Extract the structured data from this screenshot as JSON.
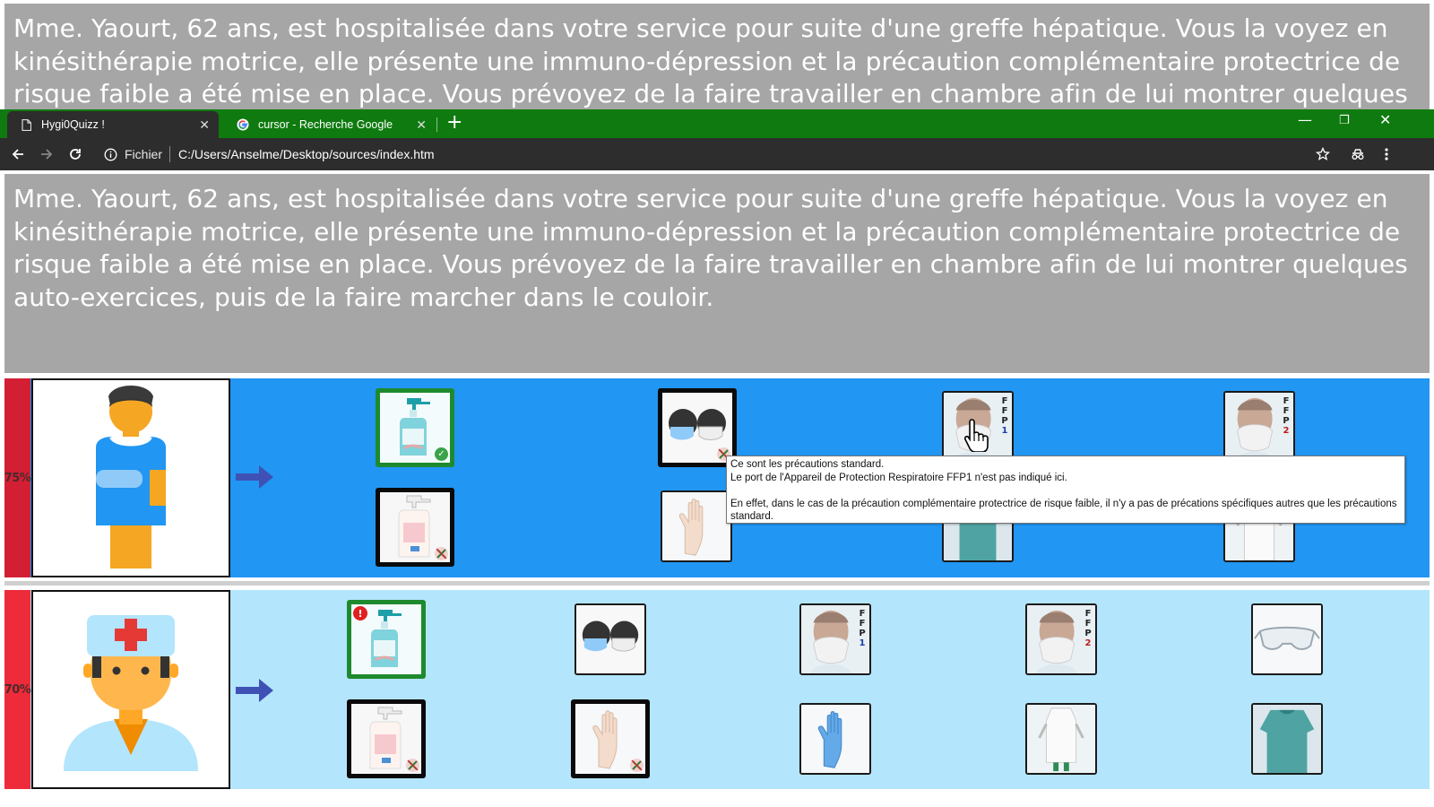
{
  "scenario": {
    "text": "Mme. Yaourt, 62 ans, est hospitalisée dans votre service pour suite d'une greffe hépatique. Vous la voyez en kinésithérapie motrice, elle présente une immuno-dépression et la précaution complémentaire protectrice de risque faible a été mise en place. Vous prévoyez de la faire travailler en chambre afin de lui montrer quelques auto-exercices, puis de la faire marcher dans le couloir."
  },
  "browser": {
    "tabs": [
      {
        "title": "Hygi0Quizz !",
        "icon": "page-icon",
        "active": true
      },
      {
        "title": "cursor - Recherche Google",
        "icon": "google-icon",
        "active": false
      }
    ],
    "new_tab": "+",
    "security_chip": "Fichier",
    "url": "C:/Users/Anselme/Desktop/sources/index.htm",
    "window_controls": {
      "minimize": "—",
      "restore": "❐",
      "close": "✕"
    }
  },
  "rows": [
    {
      "score": "75%",
      "role": "patient",
      "avatar_icon": "patient-icon",
      "items": [
        {
          "name": "hydroalcoholic-gel",
          "state": "selected-correct",
          "badge": "✓"
        },
        {
          "name": "surgical-masks",
          "state": "selected-wrong"
        },
        {
          "name": "ffp1-respirator",
          "state": "unselected",
          "ffp": [
            "F",
            "F",
            "P",
            "1"
          ]
        },
        {
          "name": "ffp2-respirator",
          "state": "unselected",
          "ffp": [
            "F",
            "F",
            "P",
            "2"
          ]
        },
        {
          "name": "soap-dispenser",
          "state": "selected-wrong"
        },
        {
          "name": "latex-gloves",
          "state": "unselected"
        },
        {
          "name": "surgical-gown",
          "state": "unselected"
        },
        {
          "name": "plastic-apron",
          "state": "unselected"
        }
      ]
    },
    {
      "score": "70%",
      "role": "nurse",
      "avatar_icon": "nurse-icon",
      "items": [
        {
          "name": "hydroalcoholic-gel",
          "state": "selected-warning",
          "badge": "!"
        },
        {
          "name": "surgical-masks",
          "state": "unselected"
        },
        {
          "name": "ffp1-respirator",
          "state": "unselected",
          "ffp": [
            "F",
            "F",
            "P",
            "1"
          ]
        },
        {
          "name": "ffp2-respirator",
          "state": "unselected",
          "ffp": [
            "F",
            "F",
            "P",
            "2"
          ]
        },
        {
          "name": "safety-goggles",
          "state": "unselected"
        },
        {
          "name": "soap-dispenser",
          "state": "selected-wrong"
        },
        {
          "name": "latex-gloves",
          "state": "selected-wrong"
        },
        {
          "name": "nitrile-gloves",
          "state": "unselected"
        },
        {
          "name": "plastic-apron",
          "state": "unselected"
        },
        {
          "name": "surgical-gown",
          "state": "unselected"
        }
      ]
    }
  ],
  "tooltip": {
    "line1": "Ce sont les précautions standard.",
    "line2": "Le port de l'Appareil de Protection Respiratoire FFP1 n'est pas indiqué ici.",
    "line3": "En effet, dans le cas de la précaution complémentaire protectrice de risque faible, il n'y a pas de précations spécifiques autres que les précautions standard."
  },
  "colors": {
    "tab_bar": "#0f7a0f",
    "toolbar": "#2d2d2d",
    "scenario_bg": "#a6a6a6",
    "row1_bg": "#2196f3",
    "row2_bg": "#b3e5fc",
    "score_red": "#d31f34",
    "selected_green": "#1e8a2e"
  }
}
